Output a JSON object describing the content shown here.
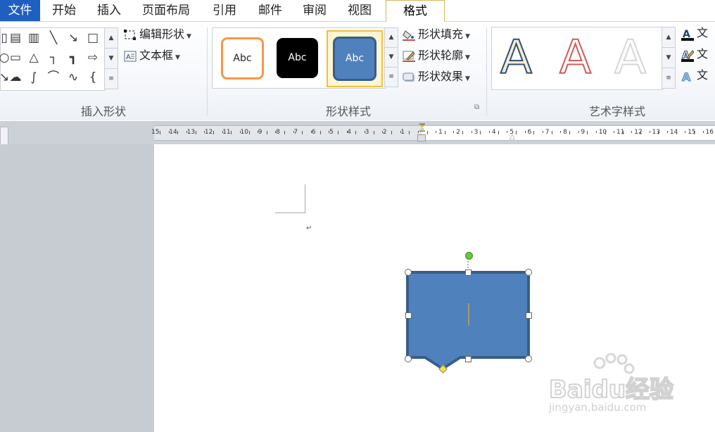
{
  "tabs": {
    "file": "文件",
    "items": [
      "开始",
      "插入",
      "页面布局",
      "引用",
      "邮件",
      "审阅",
      "视图"
    ],
    "active": "格式"
  },
  "groups": {
    "insert_shapes": {
      "label": "插入形状",
      "edit_shape": "编辑形状",
      "text_box": "文本框"
    },
    "shape_styles": {
      "label": "形状样式",
      "preview_text": "Abc",
      "fill": "形状填充",
      "outline": "形状轮廓",
      "effects": "形状效果"
    },
    "wordart_styles": {
      "label": "艺术字样式",
      "letter": "A",
      "text_cmd": "文"
    }
  },
  "ruler": {
    "left_numbers": [
      "15",
      "14",
      "13",
      "12",
      "11",
      "10",
      "9",
      "8",
      "7",
      "6",
      "5",
      "4",
      "3",
      "2",
      "1"
    ],
    "right_numbers": [
      "1",
      "2",
      "3",
      "4",
      "5",
      "6",
      "7",
      "8",
      "9",
      "10",
      "11",
      "12",
      "13",
      "14",
      "15",
      "16"
    ]
  },
  "document": {
    "paragraph_mark": "↵"
  },
  "watermark": {
    "brand": "Baidu经验",
    "url": "jingyan.baidu.com"
  },
  "colors": {
    "file_tab": "#1f5fbf",
    "shape_fill": "#4f81bd",
    "shape_border": "#385d8a",
    "accent_orange": "#f79646",
    "selected_style_border": "#f0c040"
  },
  "icons": [
    "shape-line-icon",
    "shape-rect-icon",
    "shape-arrow-icon",
    "edit-shape-icon",
    "text-box-icon",
    "paint-bucket-icon",
    "pen-outline-icon",
    "shape-effect-icon",
    "rotation-handle-icon",
    "scroll-up-icon",
    "scroll-down-icon",
    "more-icon",
    "dialog-launcher-icon"
  ]
}
